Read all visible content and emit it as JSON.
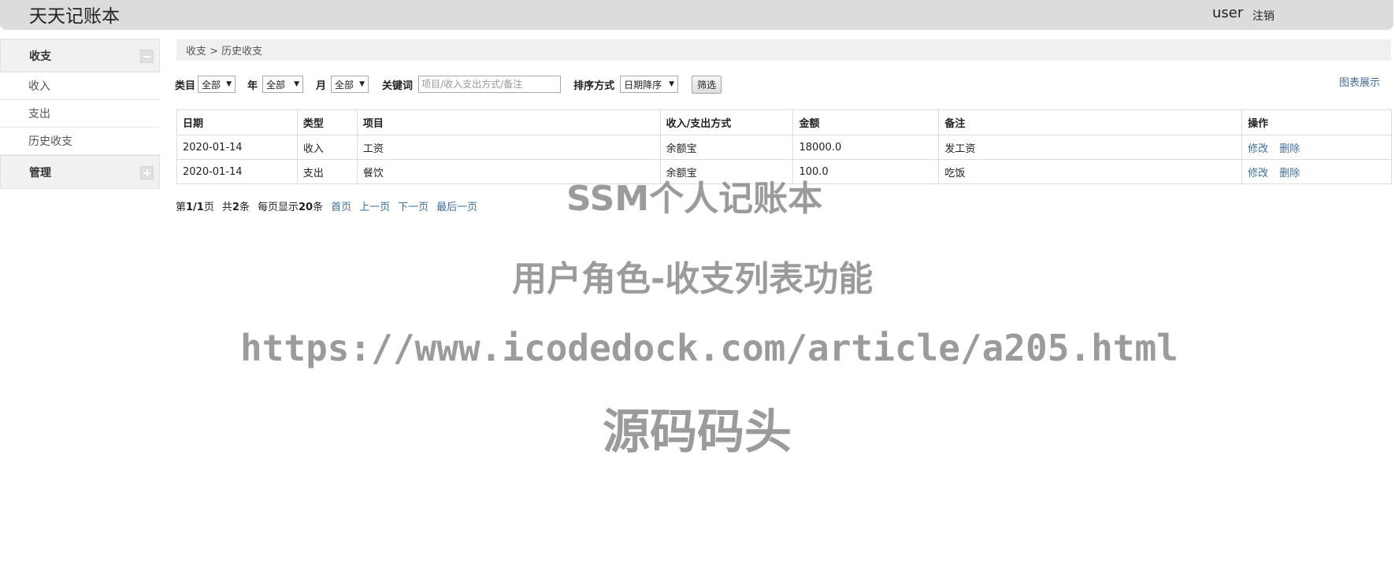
{
  "header": {
    "app_title": "天天记账本",
    "user_name": "user",
    "logout_label": "注销"
  },
  "sidebar": {
    "groups": [
      {
        "label": "收支",
        "toggle": "minus-icon"
      },
      {
        "label": "管理",
        "toggle": "plus-icon"
      }
    ],
    "items": [
      {
        "label": "收入"
      },
      {
        "label": "支出"
      },
      {
        "label": "历史收支"
      }
    ]
  },
  "breadcrumb": "收支 > 历史收支",
  "filters": {
    "category_label": "类目",
    "category_value": "全部",
    "year_label": "年",
    "year_value": "全部",
    "month_label": "月",
    "month_value": "全部",
    "keyword_label": "关键词",
    "keyword_placeholder": "项目/收入支出方式/备注",
    "sort_label": "排序方式",
    "sort_value": "日期降序",
    "filter_button": "筛选",
    "chart_link": "图表展示"
  },
  "table": {
    "headers": [
      "日期",
      "类型",
      "项目",
      "收入/支出方式",
      "金额",
      "备注",
      "操作"
    ],
    "rows": [
      {
        "date": "2020-01-14",
        "type": "收入",
        "item": "工资",
        "method": "余额宝",
        "amount": "18000.0",
        "note": "发工资",
        "edit": "修改",
        "delete": "删除"
      },
      {
        "date": "2020-01-14",
        "type": "支出",
        "item": "餐饮",
        "method": "余额宝",
        "amount": "100.0",
        "note": "吃饭",
        "edit": "修改",
        "delete": "删除"
      }
    ]
  },
  "pagination": {
    "page_prefix": "第",
    "page_current": "1/1",
    "page_suffix": "页",
    "total_prefix": "共",
    "total_count": "2",
    "total_suffix": "条",
    "per_page_prefix": "每页显示",
    "per_page": "20",
    "per_page_suffix": "条",
    "first": "首页",
    "prev": "上一页",
    "next": "下一页",
    "last": "最后一页"
  },
  "watermark": {
    "line1": "SSM个人记账本",
    "line2": "用户角色-收支列表功能",
    "line3": "https://www.icodedock.com/article/a205.html",
    "line4": "源码码头"
  },
  "colors": {
    "header_bg": "#dcdcdc",
    "link": "#3f6f9a",
    "sidebar_header_bg": "#f1f1f1"
  }
}
